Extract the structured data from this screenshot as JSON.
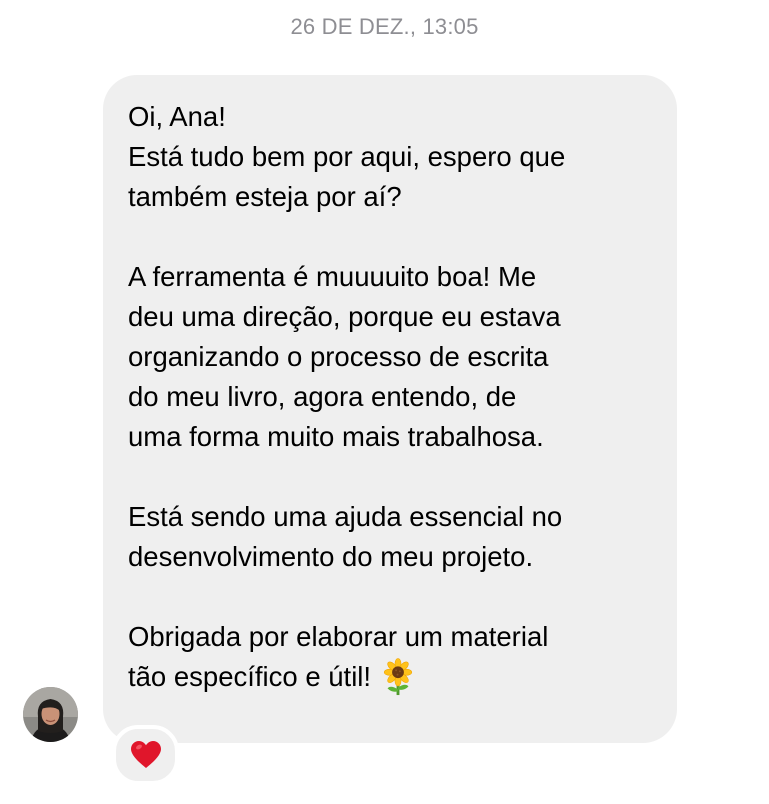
{
  "header": {
    "timestamp": "26 DE DEZ., 13:05"
  },
  "message": {
    "paragraphs": [
      "Oi, Ana!\nEstá tudo bem por aqui, espero que\ntambém esteja por aí?",
      "A ferramenta é muuuuito boa! Me\ndeu uma direção, porque eu estava\norganizando o processo de escrita\ndo meu livro, agora entendo, de\numa forma muito mais trabalhosa.",
      "Está sendo uma ajuda essencial no\ndesenvolvimento do meu projeto.",
      "Obrigada por elaborar um material\ntão específico e útil!"
    ],
    "trailing_emoji": "sunflower",
    "bubble_color": "#efefef"
  },
  "sender": {
    "avatar": "profile-photo"
  },
  "reaction": {
    "emoji": "red-heart",
    "color": "#e0162b"
  }
}
